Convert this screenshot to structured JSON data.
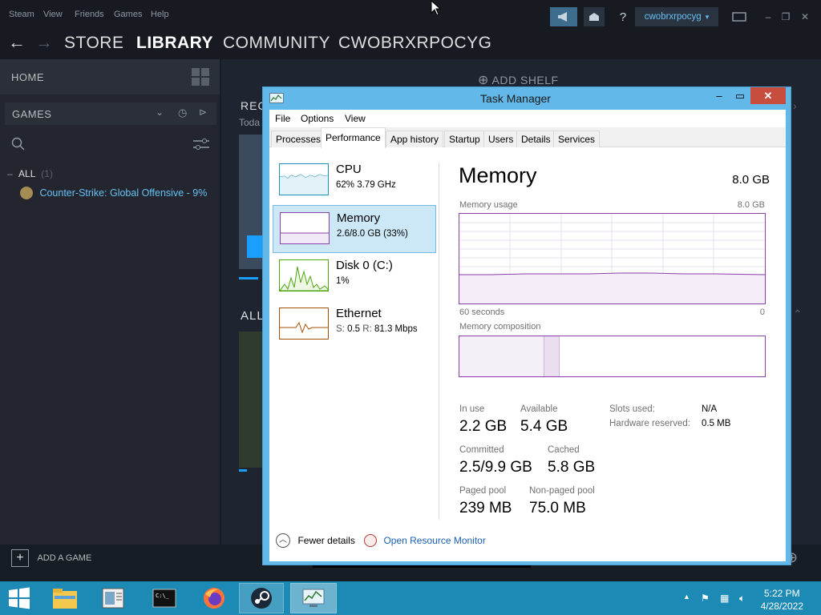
{
  "steam": {
    "menu": [
      "Steam",
      "View",
      "Friends",
      "Games",
      "Help"
    ],
    "account_name": "cwobrxrpocyg",
    "nav": {
      "store": "STORE",
      "library": "LIBRARY",
      "community": "COMMUNITY",
      "profile": "CWOBRXRPOCYG"
    },
    "sidebar": {
      "home": "HOME",
      "games_filter": "GAMES",
      "all_label": "ALL",
      "all_count": "(1)",
      "game_item": "Counter-Strike: Global Offensive - 9%"
    },
    "main": {
      "add_shelf": "ADD SHELF",
      "recent_heading": "REC",
      "recent_sub": "Toda",
      "all_heading": "ALL"
    },
    "add_game": "ADD A GAME"
  },
  "task_manager": {
    "title": "Task Manager",
    "menu": [
      "File",
      "Options",
      "View"
    ],
    "tabs": [
      "Processes",
      "Performance",
      "App history",
      "Startup",
      "Users",
      "Details",
      "Services"
    ],
    "active_tab": "Performance",
    "resources": [
      {
        "name": "CPU",
        "detail": "62%  3.79 GHz",
        "color": "#1e90b8"
      },
      {
        "name": "Memory",
        "detail": "2.6/8.0 GB (33%)",
        "color": "#8b3faa"
      },
      {
        "name": "Disk 0 (C:)",
        "detail": "1%",
        "color": "#4da60c"
      },
      {
        "name": "Ethernet",
        "detail_prefix_s": "S:",
        "detail_s": "0.5",
        "detail_prefix_r": "R:",
        "detail_r": "81.3 Mbps",
        "color": "#a74f01"
      }
    ],
    "selected_resource": "Memory",
    "detail": {
      "title": "Memory",
      "total": "8.0 GB",
      "usage_label": "Memory usage",
      "usage_max": "8.0 GB",
      "axis_left": "60 seconds",
      "axis_right": "0",
      "composition_label": "Memory composition",
      "usage_fraction": 0.33,
      "in_use_label": "In use",
      "in_use": "2.2 GB",
      "available_label": "Available",
      "available": "5.4 GB",
      "committed_label": "Committed",
      "committed": "2.5/9.9 GB",
      "cached_label": "Cached",
      "cached": "5.8 GB",
      "paged_label": "Paged pool",
      "paged": "239 MB",
      "nonpaged_label": "Non-paged pool",
      "nonpaged": "75.0 MB",
      "slots_label": "Slots used:",
      "slots": "N/A",
      "hw_label": "Hardware reserved:",
      "hw": "0.5 MB"
    },
    "footer": {
      "fewer": "Fewer details",
      "resmon": "Open Resource Monitor"
    }
  },
  "taskbar": {
    "time": "5:22 PM",
    "date": "4/28/2022"
  },
  "colors": {
    "memory_accent": "#8b3faa",
    "taskbar": "#1d8ab6",
    "link": "#1a5fb4"
  }
}
